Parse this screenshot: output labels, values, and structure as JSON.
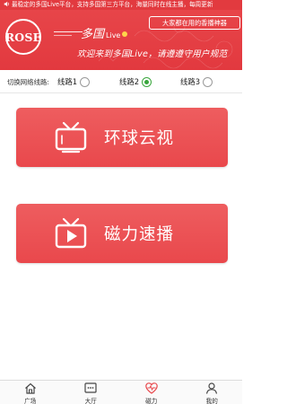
{
  "header": {
    "marquee": "最稳定的多国Live平台，支持多国第三方平台，海量同时在线主播，每周更新",
    "logo_text": "ROSE",
    "brand_title": "多国",
    "brand_live": "Live",
    "tag": "大家都在用的香播神器",
    "welcome": "欢迎来到多国Live，请遵遵守用户规范",
    "accent_color": "#e8474b"
  },
  "line_selector": {
    "label": "切换网络线路:",
    "options": [
      {
        "label": "线路1",
        "selected": false
      },
      {
        "label": "线路2",
        "selected": true
      },
      {
        "label": "线路3",
        "selected": false
      }
    ]
  },
  "buttons": [
    {
      "label": "环球云视",
      "icon": "tv-icon"
    },
    {
      "label": "磁力速播",
      "icon": "play-tv-icon"
    }
  ],
  "nav": {
    "items": [
      {
        "label": "广场",
        "icon": "home-icon"
      },
      {
        "label": "大厅",
        "icon": "chat-icon"
      },
      {
        "label": "磁力",
        "icon": "heart-pulse-icon"
      },
      {
        "label": "我的",
        "icon": "user-icon"
      }
    ],
    "active_index": 2
  }
}
